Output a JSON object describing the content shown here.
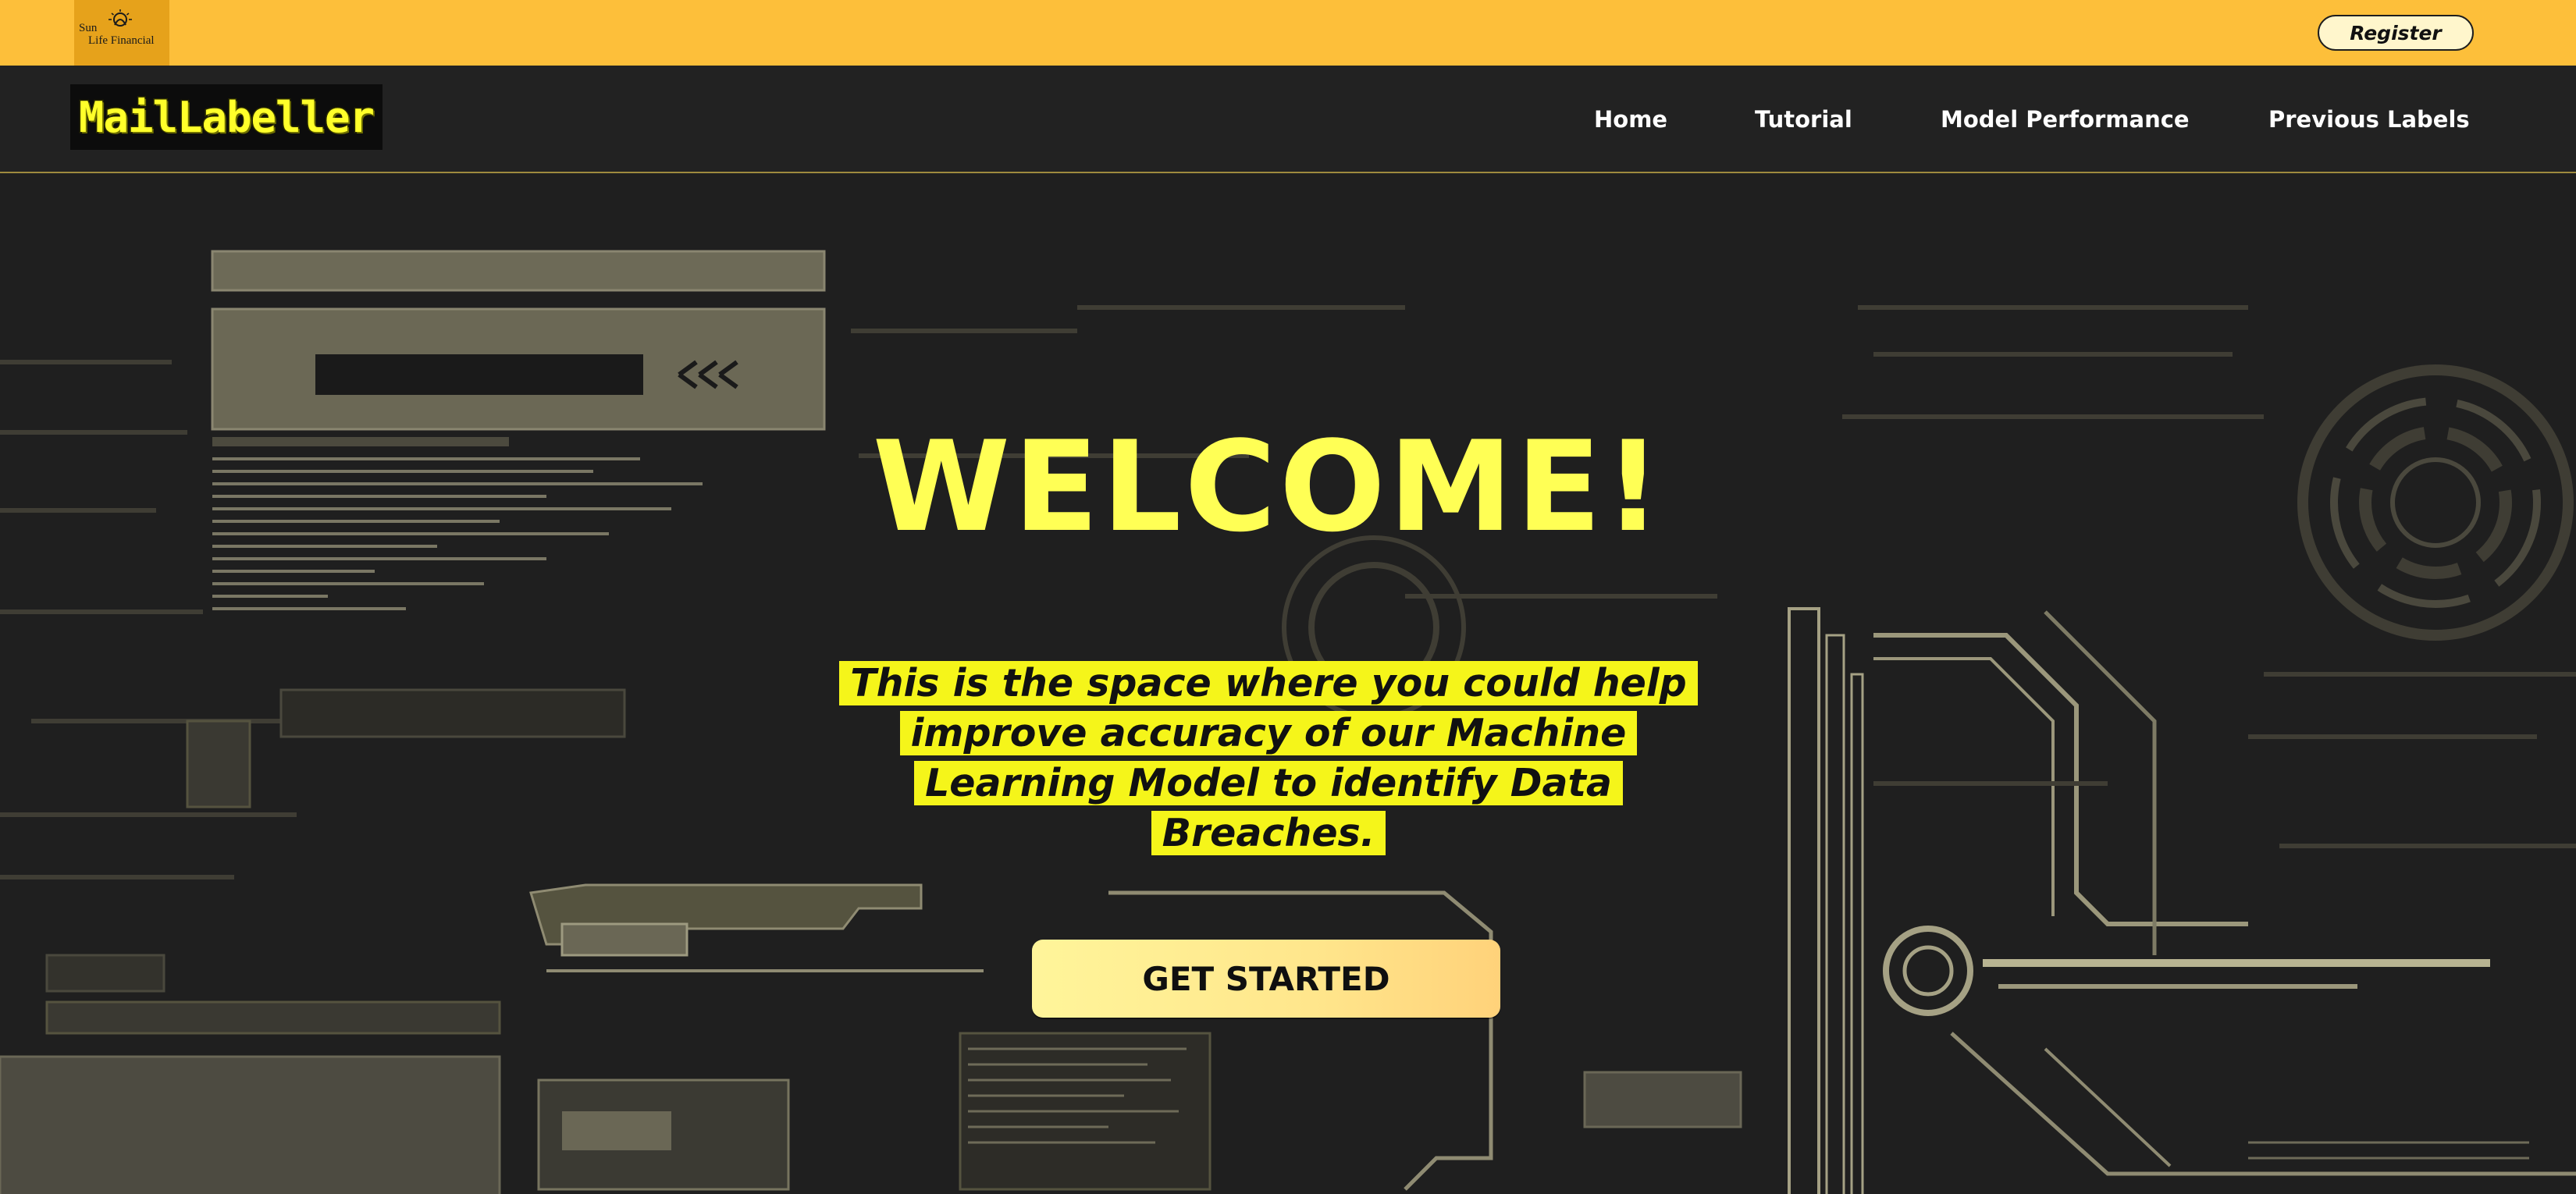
{
  "brand": {
    "line1": "Sun",
    "line2": "Life Financial",
    "icon": "sun-logo-icon"
  },
  "header": {
    "register_label": "Register"
  },
  "navbar": {
    "logo_text": "MailLabeller",
    "links": [
      {
        "label": "Home"
      },
      {
        "label": "Tutorial"
      },
      {
        "label": "Model Performance"
      },
      {
        "label": "Previous Labels"
      }
    ]
  },
  "hero": {
    "title": "WELCOME!",
    "tagline": "This is the space where you could help improve accuracy of our Machine Learning Model to identify Data Breaches.",
    "cta_label": "GET STARTED"
  },
  "colors": {
    "topbar": "#fdbf3a",
    "accent_yellow": "#ffff55",
    "highlight": "#f5f51a",
    "background": "#1f1f1f",
    "navbar": "#222222"
  }
}
